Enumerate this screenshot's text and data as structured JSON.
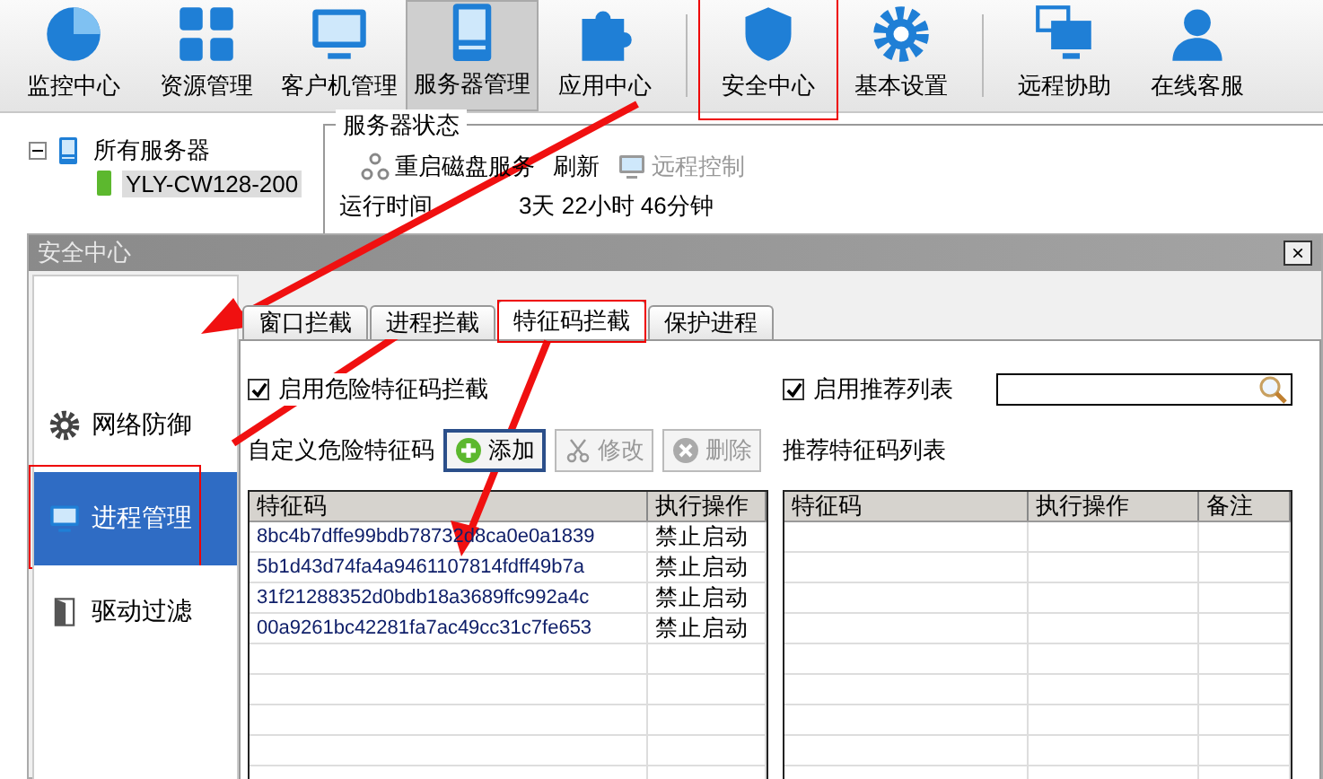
{
  "toolbar": [
    {
      "label": "监控中心",
      "selected": false,
      "highlighted": false
    },
    {
      "label": "资源管理",
      "selected": false,
      "highlighted": false
    },
    {
      "label": "客户机管理",
      "selected": false,
      "highlighted": false
    },
    {
      "label": "服务器管理",
      "selected": true,
      "highlighted": false
    },
    {
      "label": "应用中心",
      "selected": false,
      "highlighted": false
    },
    {
      "label": "安全中心",
      "selected": false,
      "highlighted": true
    },
    {
      "label": "基本设置",
      "selected": false,
      "highlighted": false
    },
    {
      "label": "远程协助",
      "selected": false,
      "highlighted": false
    },
    {
      "label": "在线客服",
      "selected": false,
      "highlighted": false
    }
  ],
  "tree": {
    "label": "所有服务器",
    "expanded": true,
    "children": [
      {
        "label": "YLY-CW128-200",
        "selected": true
      }
    ]
  },
  "server_status": {
    "title": "服务器状态",
    "actions": [
      {
        "label": "重启磁盘服务",
        "disabled": false
      },
      {
        "label": "刷新",
        "disabled": false
      },
      {
        "label": "远程控制",
        "disabled": true
      }
    ],
    "rows": [
      {
        "label": "运行时间",
        "value": "3天 22小时 46分钟"
      }
    ]
  },
  "dialog": {
    "title": "安全中心",
    "close": "×",
    "nav": [
      {
        "label": "网络防御",
        "selected": false,
        "highlighted": false
      },
      {
        "label": "进程管理",
        "selected": true,
        "highlighted": true
      },
      {
        "label": "驱动过滤",
        "selected": false,
        "highlighted": false
      }
    ],
    "tabs": [
      {
        "label": "窗口拦截",
        "selected": false,
        "highlighted": false
      },
      {
        "label": "进程拦截",
        "selected": false,
        "highlighted": false
      },
      {
        "label": "特征码拦截",
        "selected": true,
        "highlighted": true
      },
      {
        "label": "保护进程",
        "selected": false,
        "highlighted": false
      }
    ],
    "left": {
      "checkbox": {
        "label": "启用危险特征码拦截",
        "checked": true
      },
      "title": "自定义危险特征码",
      "buttons": [
        {
          "label": "添加",
          "disabled": false
        },
        {
          "label": "修改",
          "disabled": true
        },
        {
          "label": "删除",
          "disabled": true
        }
      ],
      "columns": [
        "特征码",
        "执行操作"
      ],
      "rows": [
        [
          "8bc4b7dffe99bdb78732d8ca0e0a1839",
          "禁止启动"
        ],
        [
          "5b1d43d74fa4a9461107814fdff49b7a",
          "禁止启动"
        ],
        [
          "31f21288352d0bdb18a3689ffc992a4c",
          "禁止启动"
        ],
        [
          "00a9261bc42281fa7ac49cc31c7fe653",
          "禁止启动"
        ]
      ]
    },
    "right": {
      "checkbox": {
        "label": "启用推荐列表",
        "checked": true
      },
      "title": "推荐特征码列表",
      "columns": [
        "特征码",
        "执行操作",
        "备注"
      ]
    }
  }
}
